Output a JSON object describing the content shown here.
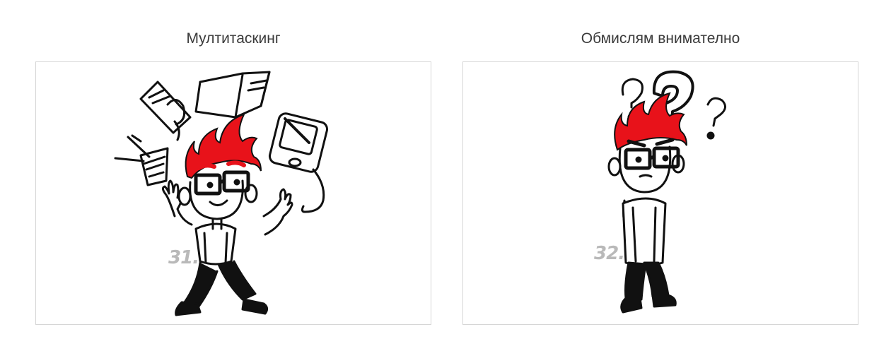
{
  "gallery": {
    "items": [
      {
        "title": "Мултитаскинг",
        "badge": "31.",
        "icon": "multitasking-illustration",
        "accent_color": "#e8121a"
      },
      {
        "title": "Обмислям внимателно",
        "badge": "32.",
        "icon": "thinking-illustration",
        "accent_color": "#e8121a"
      }
    ]
  }
}
